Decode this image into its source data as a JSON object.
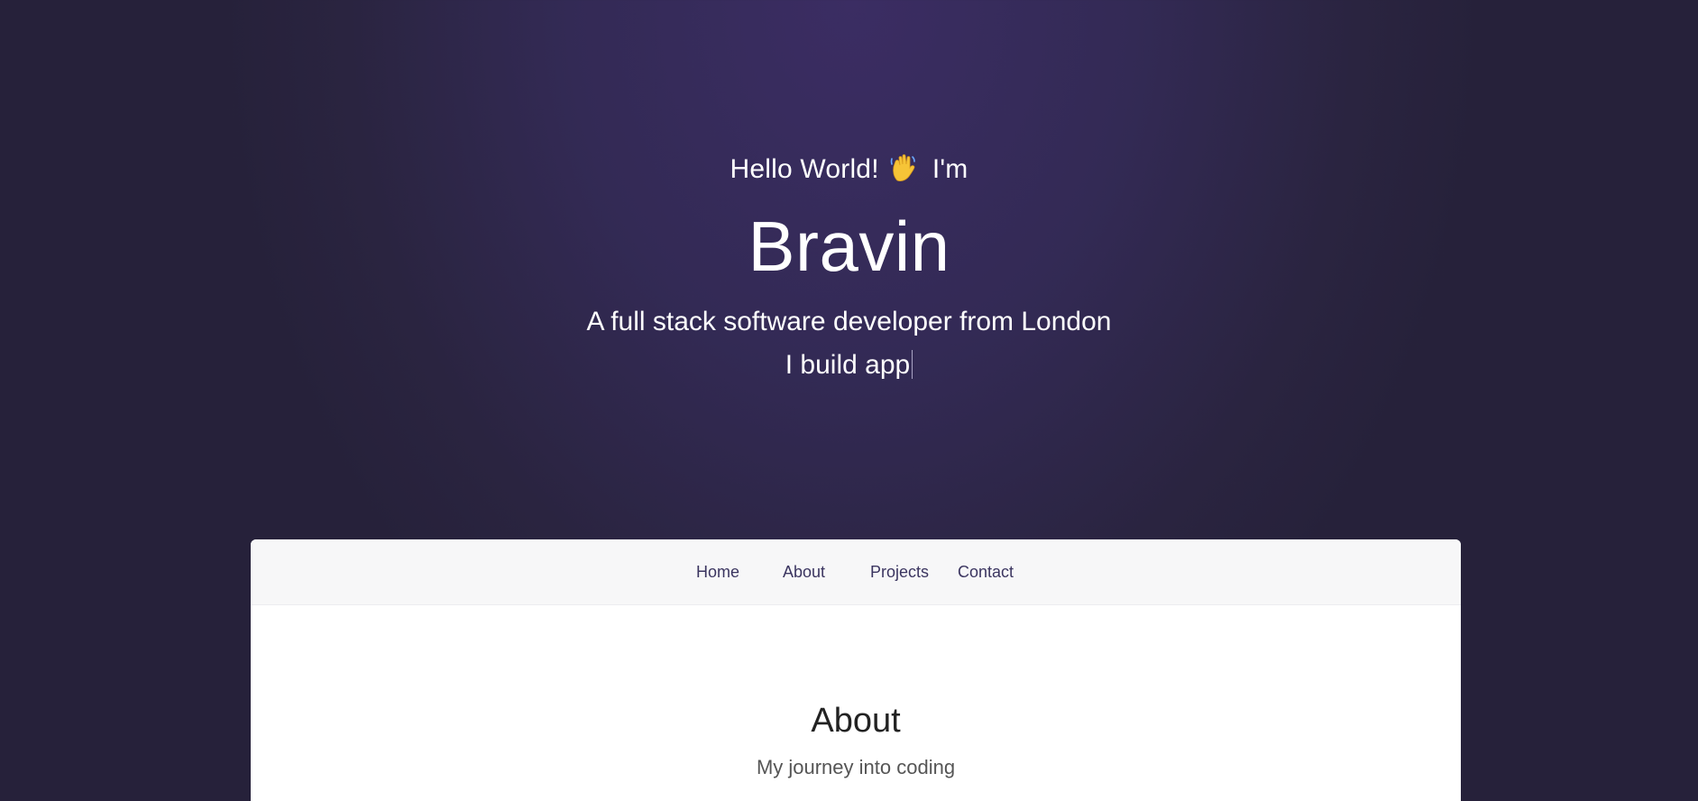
{
  "hero": {
    "greeting_prefix": "Hello World!",
    "greeting_suffix": "I'm",
    "wave_icon": "waving-hand-icon",
    "name": "Bravin",
    "tagline": "A full stack software developer from London",
    "typed_text": "I build app"
  },
  "nav": {
    "items": [
      {
        "label": "Home"
      },
      {
        "label": "About"
      },
      {
        "label": "Projects"
      },
      {
        "label": "Contact"
      }
    ]
  },
  "about": {
    "title": "About",
    "subtitle": "My journey into coding"
  },
  "colors": {
    "hero_bg": "#332a55",
    "nav_text": "#3b3560",
    "card_bg": "#ffffff",
    "navbar_bg": "#f7f7f8"
  }
}
